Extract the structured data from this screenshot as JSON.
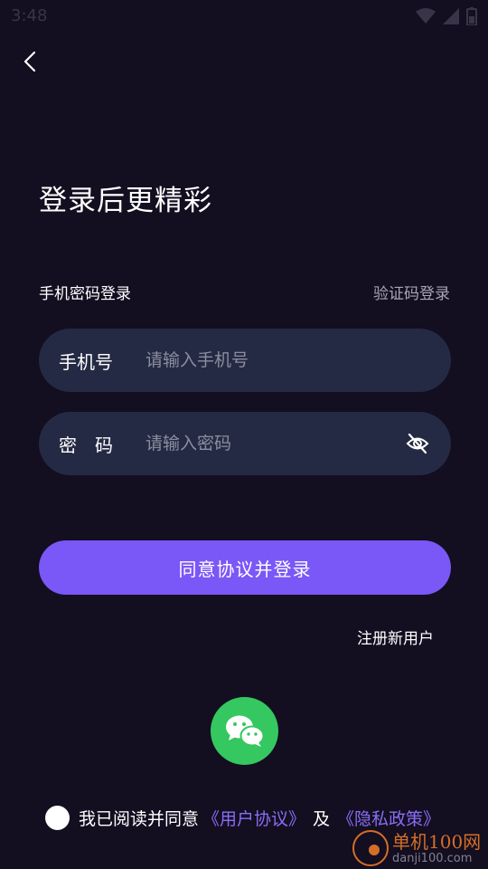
{
  "status_bar": {
    "time": "3:48",
    "icons": [
      "wifi-icon",
      "signal-icon",
      "battery-icon"
    ]
  },
  "header": {
    "back_icon": "chevron-left-icon",
    "title": "登录后更精彩"
  },
  "login_mode": {
    "current": "手机密码登录",
    "switch_label": "验证码登录"
  },
  "form": {
    "phone": {
      "label": "手机号",
      "placeholder": "请输入手机号",
      "value": ""
    },
    "password": {
      "label": "密码",
      "placeholder": "请输入密码",
      "value": "",
      "toggle_icon": "eye-off-icon"
    },
    "submit_label": "同意协议并登录"
  },
  "register_label": "注册新用户",
  "social": {
    "wechat_icon": "wechat-icon"
  },
  "agreement": {
    "checked": false,
    "prefix": "我已阅读并同意",
    "user_agreement": "《用户协议》",
    "and": "及",
    "privacy_policy": "《隐私政策》"
  },
  "watermark": {
    "cn": "单机100网",
    "en": "danji100.com"
  },
  "colors": {
    "background": "#130e20",
    "field_bg": "#252a44",
    "accent": "#7a57f7",
    "link": "#8a6df5",
    "wechat": "#35c760"
  }
}
